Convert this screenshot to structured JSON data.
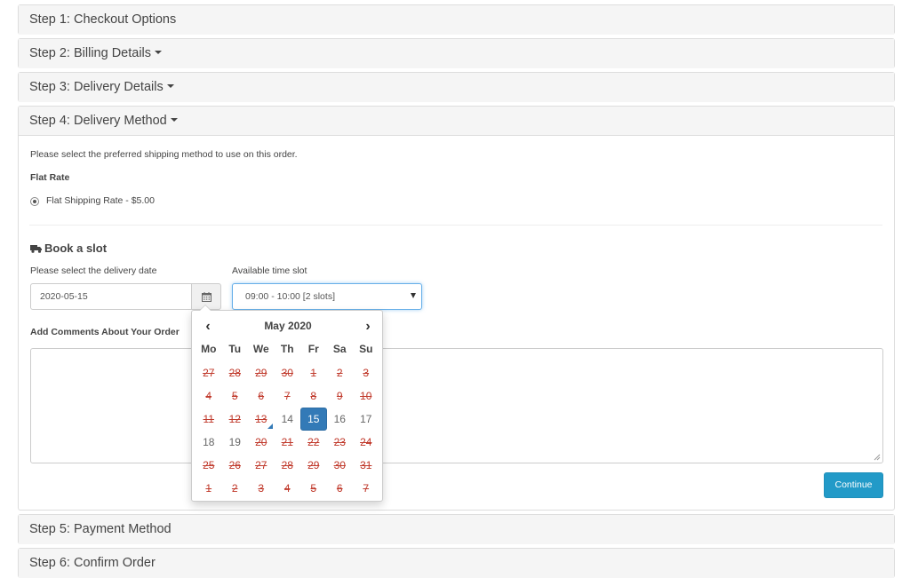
{
  "steps": [
    {
      "label": "Step 1: Checkout Options"
    },
    {
      "label": "Step 2: Billing Details"
    },
    {
      "label": "Step 3: Delivery Details"
    },
    {
      "label": "Step 4: Delivery Method"
    },
    {
      "label": "Step 5: Payment Method"
    },
    {
      "label": "Step 6: Confirm Order"
    }
  ],
  "delivery": {
    "intro": "Please select the preferred shipping method to use on this order.",
    "method_heading": "Flat Rate",
    "method_option": "Flat Shipping Rate - $5.00",
    "book_slot_heading": "Book a slot",
    "date_label": "Please select the delivery date",
    "date_value": "2020-05-15",
    "slot_label": "Available time slot",
    "slot_value": "09:00 - 10:00 [2 slots]",
    "comments_label": "Add Comments About Your Order",
    "comments_value": "",
    "continue_label": "Continue"
  },
  "datepicker": {
    "title": "May 2020",
    "prev": "‹",
    "next": "›",
    "weekdays": [
      "Mo",
      "Tu",
      "We",
      "Th",
      "Fr",
      "Sa",
      "Su"
    ],
    "days": [
      {
        "d": "27",
        "s": "disabled"
      },
      {
        "d": "28",
        "s": "disabled"
      },
      {
        "d": "29",
        "s": "disabled"
      },
      {
        "d": "30",
        "s": "disabled"
      },
      {
        "d": "1",
        "s": "disabled"
      },
      {
        "d": "2",
        "s": "disabled"
      },
      {
        "d": "3",
        "s": "disabled"
      },
      {
        "d": "4",
        "s": "disabled"
      },
      {
        "d": "5",
        "s": "disabled"
      },
      {
        "d": "6",
        "s": "disabled"
      },
      {
        "d": "7",
        "s": "disabled"
      },
      {
        "d": "8",
        "s": "disabled"
      },
      {
        "d": "9",
        "s": "disabled"
      },
      {
        "d": "10",
        "s": "disabled"
      },
      {
        "d": "11",
        "s": "disabled"
      },
      {
        "d": "12",
        "s": "disabled"
      },
      {
        "d": "13",
        "s": "disabled today"
      },
      {
        "d": "14",
        "s": ""
      },
      {
        "d": "15",
        "s": "active"
      },
      {
        "d": "16",
        "s": ""
      },
      {
        "d": "17",
        "s": ""
      },
      {
        "d": "18",
        "s": ""
      },
      {
        "d": "19",
        "s": ""
      },
      {
        "d": "20",
        "s": "disabled"
      },
      {
        "d": "21",
        "s": "disabled"
      },
      {
        "d": "22",
        "s": "disabled"
      },
      {
        "d": "23",
        "s": "disabled"
      },
      {
        "d": "24",
        "s": "disabled"
      },
      {
        "d": "25",
        "s": "disabled"
      },
      {
        "d": "26",
        "s": "disabled"
      },
      {
        "d": "27",
        "s": "disabled"
      },
      {
        "d": "28",
        "s": "disabled"
      },
      {
        "d": "29",
        "s": "disabled"
      },
      {
        "d": "30",
        "s": "disabled"
      },
      {
        "d": "31",
        "s": "disabled"
      },
      {
        "d": "1",
        "s": "disabled"
      },
      {
        "d": "2",
        "s": "disabled"
      },
      {
        "d": "3",
        "s": "disabled"
      },
      {
        "d": "4",
        "s": "disabled"
      },
      {
        "d": "5",
        "s": "disabled"
      },
      {
        "d": "6",
        "s": "disabled"
      },
      {
        "d": "7",
        "s": "disabled"
      }
    ]
  },
  "icons": {
    "truck": "truck-icon",
    "calendar": "calendar-icon",
    "caret": "caret-down-icon"
  },
  "colors": {
    "accent": "#229ac8",
    "selected_day": "#337ab7",
    "disabled_day": "#c0392b"
  }
}
